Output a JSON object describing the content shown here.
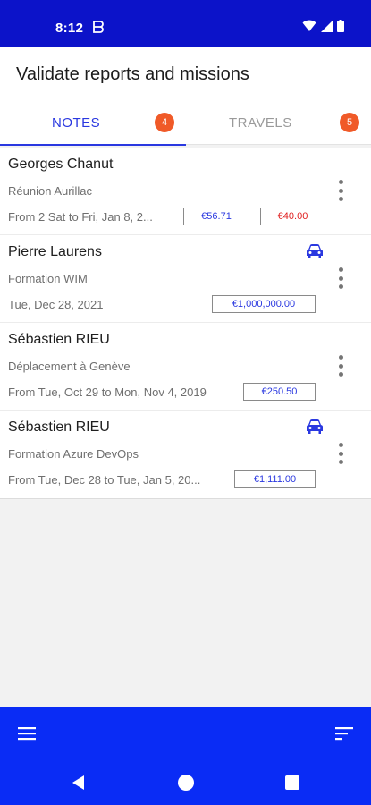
{
  "status_bar": {
    "time": "8:12",
    "icons": [
      "app-notification-icon",
      "wifi-icon",
      "signal-icon",
      "battery-icon"
    ]
  },
  "header": {
    "title": "Validate reports and missions"
  },
  "tabs": [
    {
      "label": "NOTES",
      "badge": "4",
      "selected": true
    },
    {
      "label": "TRAVELS",
      "badge": "5",
      "selected": false
    }
  ],
  "items": [
    {
      "name": "Georges Chanut",
      "subtitle": "Réunion Aurillac",
      "dates": "From 2 Sat to Fri, Jan 8, 2...",
      "amount": "€56.71",
      "amount2": "€40.00",
      "has_car_icon": false
    },
    {
      "name": "Pierre Laurens",
      "subtitle": "Formation WIM",
      "dates": "Tue, Dec 28, 2021",
      "amount": "€1,000,000.00",
      "has_car_icon": true
    },
    {
      "name": "Sébastien RIEU",
      "subtitle": "Déplacement à Genève",
      "dates": "From Tue, Oct 29 to Mon, Nov 4, 2019",
      "amount": "€250.50",
      "has_car_icon": false
    },
    {
      "name": "Sébastien RIEU",
      "subtitle": "Formation Azure DevOps",
      "dates": "From Tue, Dec 28 to Tue, Jan 5, 20...",
      "amount": "€1,111.00",
      "has_car_icon": true
    }
  ],
  "bottom_bar": {
    "left_icon": "menu-icon",
    "right_icon": "sort-icon"
  },
  "colors": {
    "status_bar": "#0c13c9",
    "bottom_bar": "#0a2cf5",
    "accent": "#2a38e0",
    "badge": "#f05a28",
    "amount_negative": "#e02020"
  }
}
